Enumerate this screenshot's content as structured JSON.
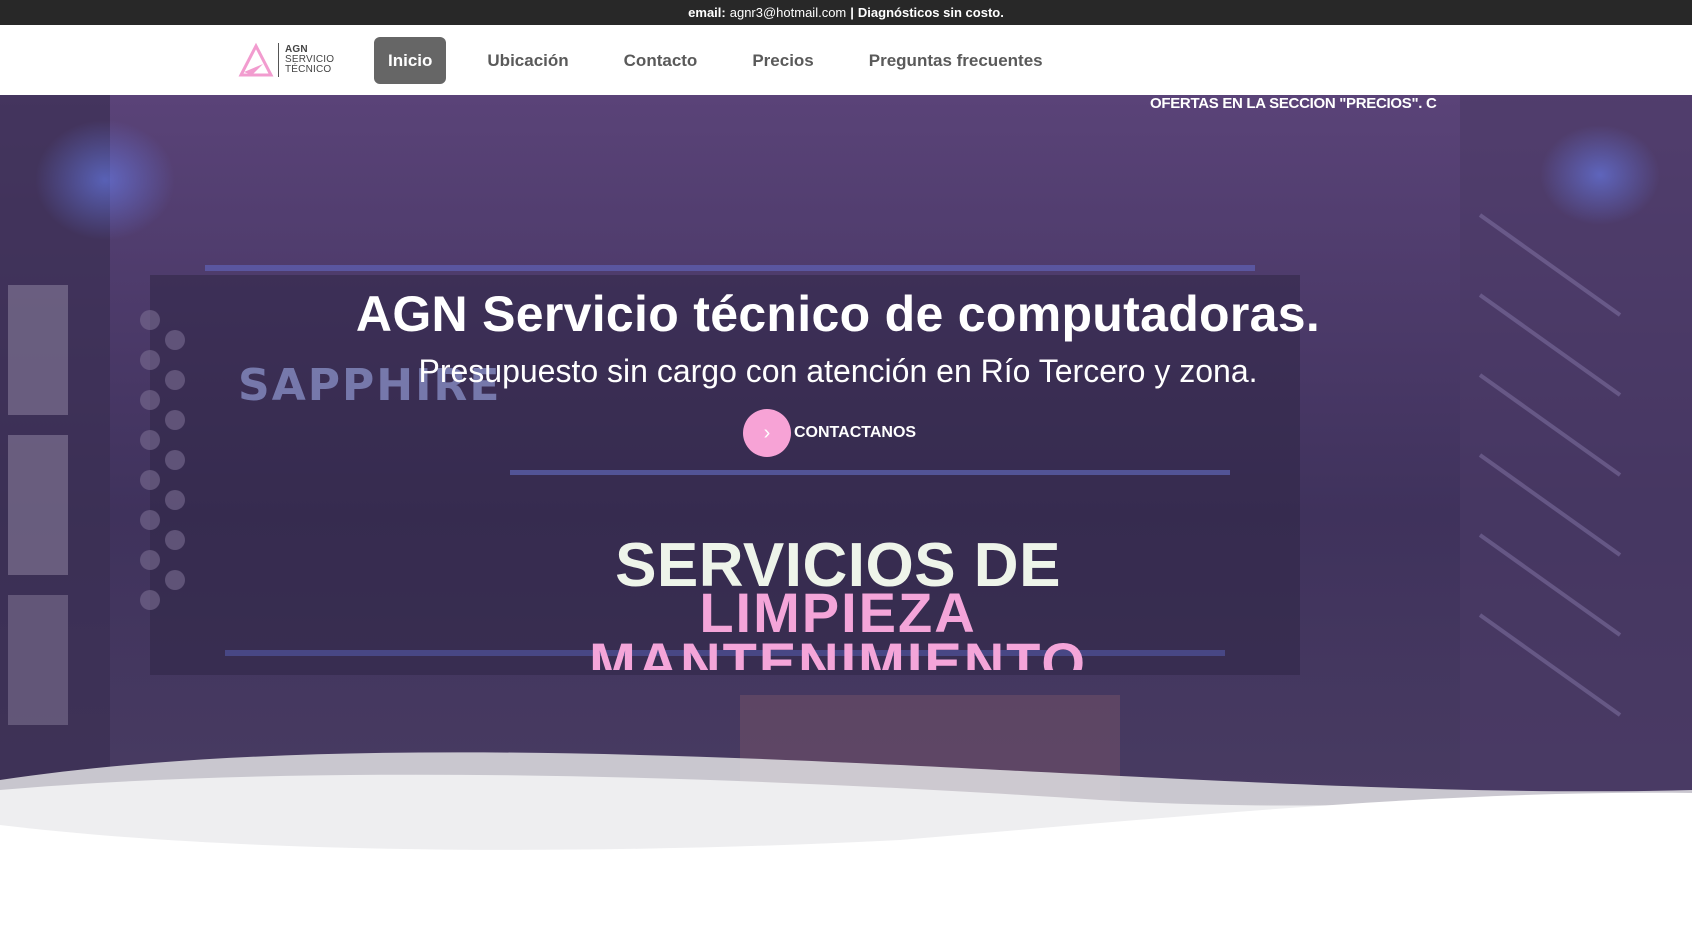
{
  "topbar": {
    "email_label": "email:",
    "email_value": "agnr3@hotmail.com",
    "separator": "|",
    "note": "Diagnósticos sin costo."
  },
  "logo": {
    "line1": "AGN",
    "line2": "SERVICIO",
    "line3": "TÉCNICO",
    "icon": "agn-logo-icon"
  },
  "nav": {
    "items": [
      {
        "label": "Inicio",
        "active": true
      },
      {
        "label": "Ubicación"
      },
      {
        "label": "Contacto"
      },
      {
        "label": "Precios"
      },
      {
        "label": "Preguntas frecuentes"
      }
    ]
  },
  "hero": {
    "marquee": "OFERTAS EN LA SECCION \"PRECIOS\". C",
    "title": "AGN Servicio técnico de computadoras.",
    "subtitle": "Presupuesto sin cargo con atención en Río Tercero y zona.",
    "cta_label": "CONTACTANOS",
    "cta_icon": "chevron-right-icon",
    "bg_text": "SAPPHIRE"
  },
  "services": {
    "title": "SERVICIOS DE",
    "words": [
      "LIMPIEZA",
      "MANTENIMIENTO"
    ]
  },
  "colors": {
    "topbar_bg": "#282828",
    "nav_active_bg": "#666666",
    "hero_overlay": "#5a4378",
    "accent_pink": "#f7a3d6",
    "services_title": "#eef4ea"
  }
}
